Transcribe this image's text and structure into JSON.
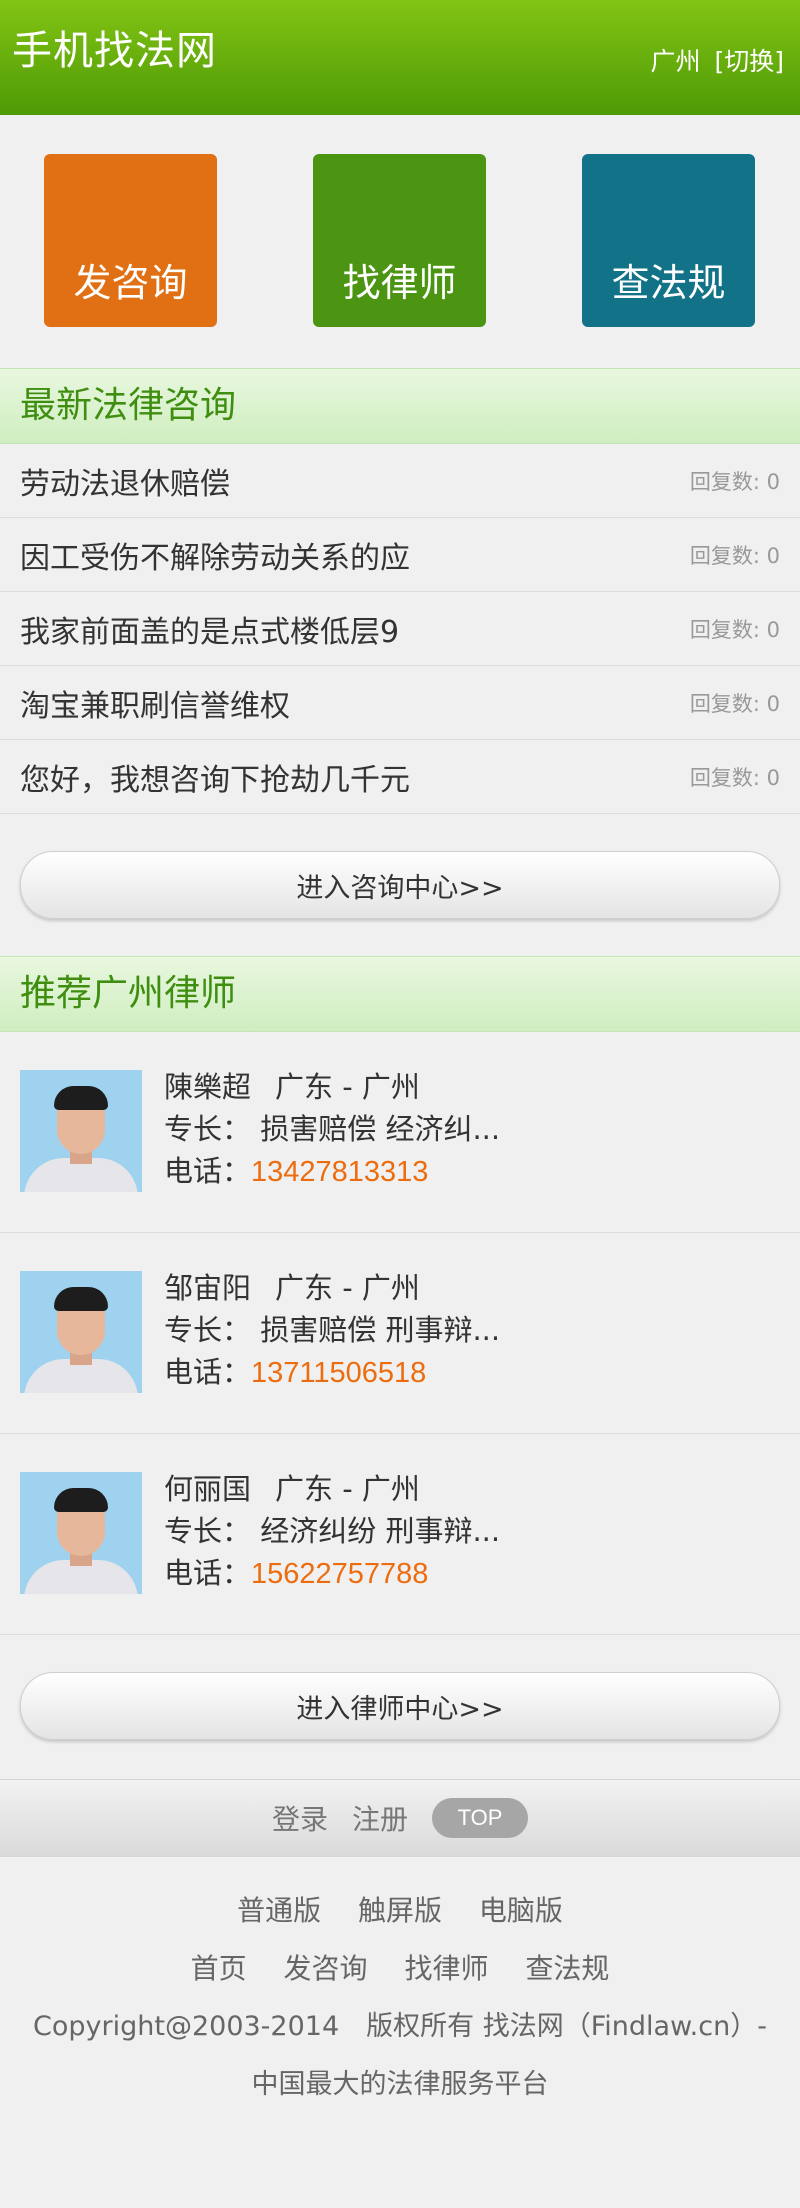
{
  "header": {
    "title": "手机找法网",
    "city": "广州",
    "switch_label": "[切换]"
  },
  "quick_actions": [
    {
      "label": "发咨询",
      "color": "#e07013"
    },
    {
      "label": "找律师",
      "color": "#4b9512"
    },
    {
      "label": "查法规",
      "color": "#127287"
    }
  ],
  "consult": {
    "title": "最新法律咨询",
    "items": [
      {
        "text": "劳动法退休赔偿",
        "reply": "回复数: 0"
      },
      {
        "text": "因工受伤不解除劳动关系的应",
        "reply": "回复数: 0"
      },
      {
        "text": "我家前面盖的是点式楼低层9",
        "reply": "回复数: 0"
      },
      {
        "text": "淘宝兼职刷信誉维权",
        "reply": "回复数: 0"
      },
      {
        "text": "您好，我想咨询下抢劫几千元",
        "reply": "回复数: 0"
      }
    ],
    "more_label": "进入咨询中心>>"
  },
  "lawyers": {
    "title": "推荐广州律师",
    "items": [
      {
        "name": "陳樂超",
        "region": "广东 - 广州",
        "specialty_label": "专长：",
        "specialty": "损害赔偿 经济纠...",
        "phone_label": "电话：",
        "phone": "13427813313"
      },
      {
        "name": "邹宙阳",
        "region": "广东 - 广州",
        "specialty_label": "专长：",
        "specialty": "损害赔偿 刑事辩...",
        "phone_label": "电话：",
        "phone": "13711506518"
      },
      {
        "name": "何丽国",
        "region": "广东 - 广州",
        "specialty_label": "专长：",
        "specialty": "经济纠纷 刑事辩...",
        "phone_label": "电话：",
        "phone": "15622757788"
      }
    ],
    "more_label": "进入律师中心>>"
  },
  "footer": {
    "login": "登录",
    "register": "注册",
    "top": "TOP",
    "versions": [
      "普通版",
      "触屏版",
      "电脑版"
    ],
    "nav": [
      "首页",
      "发咨询",
      "找律师",
      "查法规"
    ],
    "copyright": "Copyright@2003-2014　版权所有 找法网（Findlaw.cn）-",
    "slogan": "中国最大的法律服务平台"
  }
}
